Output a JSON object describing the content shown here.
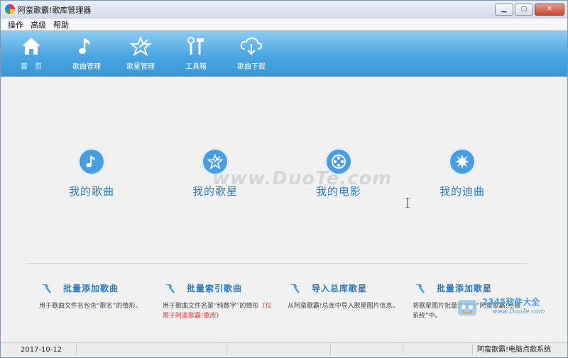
{
  "window": {
    "title": "阿蛮歌霸!歌库管理器"
  },
  "menu": [
    "操作",
    "高级",
    "帮助"
  ],
  "toolbar": [
    {
      "label": "首　页",
      "icon": "home-icon"
    },
    {
      "label": "歌曲管理",
      "icon": "music-note-icon"
    },
    {
      "label": "歌星管理",
      "icon": "star-icon"
    },
    {
      "label": "工具箱",
      "icon": "tools-icon"
    },
    {
      "label": "歌曲下载",
      "icon": "cloud-download-icon"
    }
  ],
  "features": [
    {
      "label": "我的歌曲",
      "icon": "music-note-icon"
    },
    {
      "label": "我的歌星",
      "icon": "star-icon"
    },
    {
      "label": "我的电影",
      "icon": "film-reel-icon"
    },
    {
      "label": "我的迪曲",
      "icon": "burst-icon"
    }
  ],
  "watermark": "www.DuoTe.com",
  "batch": [
    {
      "title": "批量添加歌曲",
      "desc": "用于歌曲文件名包含“歌名”的情形。",
      "note": ""
    },
    {
      "title": "批量索引歌曲",
      "desc": "用于歌曲文件名是“纯数字”的情形（",
      "note": "仅限于阿蛮歌霸!歌库",
      "desc_end": "）"
    },
    {
      "title": "导入总库歌星",
      "desc": "从阿蛮歌霸!总库中导入歌星图片信息。",
      "note": ""
    },
    {
      "title": "批量添加歌星",
      "desc": "将歌星图片批量添加到“阿蛮歌霸!点歌系统”中。",
      "note": ""
    }
  ],
  "corner_logo": {
    "brand": "2345软件大全",
    "url": "www.DuoTe.com"
  },
  "status": {
    "date": "2017-10-12",
    "app_name": "阿蛮歌霸!电脑点歌系统"
  },
  "colors": {
    "accent": "#4a9de0",
    "toolbar": "#4ba6e2",
    "link": "#2a7bc4",
    "warn": "#e53935"
  }
}
